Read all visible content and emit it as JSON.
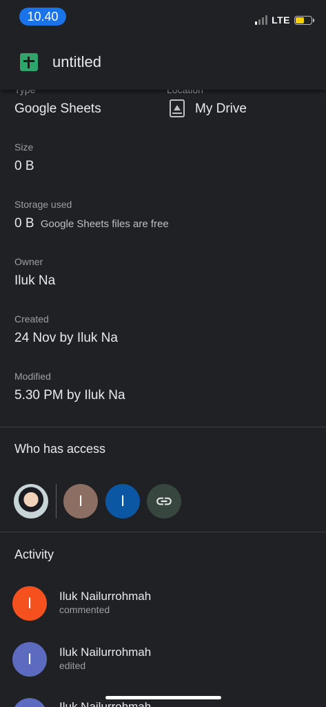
{
  "status_bar": {
    "time": "10.40",
    "network": "LTE",
    "signal_bars_on": 1,
    "battery_color": "#f5d100"
  },
  "app_bar": {
    "title": "untitled",
    "icon": "google-sheets-icon"
  },
  "details": {
    "type": {
      "label": "Type",
      "value": "Google Sheets"
    },
    "location": {
      "label": "Location",
      "value": "My Drive",
      "icon": "my-drive-icon"
    },
    "size": {
      "label": "Size",
      "value": "0 B"
    },
    "storage": {
      "label": "Storage used",
      "value": "0 B",
      "note": "Google Sheets files are free"
    },
    "owner": {
      "label": "Owner",
      "value": "Iluk Na"
    },
    "created": {
      "label": "Created",
      "value": "24 Nov by Iluk Na"
    },
    "modified": {
      "label": "Modified",
      "value": "5.30 PM by Iluk Na"
    }
  },
  "access": {
    "title": "Who has access",
    "avatars": [
      {
        "type": "photo"
      },
      {
        "letter": "I",
        "color": "#8d6e63"
      },
      {
        "letter": "I",
        "color": "#0b57a4"
      },
      {
        "type": "link",
        "icon": "link-icon",
        "color": "#37473f"
      }
    ]
  },
  "activity": {
    "title": "Activity",
    "items": [
      {
        "letter": "I",
        "color": "#f4511e",
        "name": "Iluk Nailurrohmah",
        "action": "commented"
      },
      {
        "letter": "I",
        "color": "#5c6bc0",
        "name": "Iluk Nailurrohmah",
        "action": "edited"
      },
      {
        "letter": "I",
        "color": "#5c6bc0",
        "name": "Iluk Nailurrohmah",
        "action": ""
      }
    ]
  }
}
